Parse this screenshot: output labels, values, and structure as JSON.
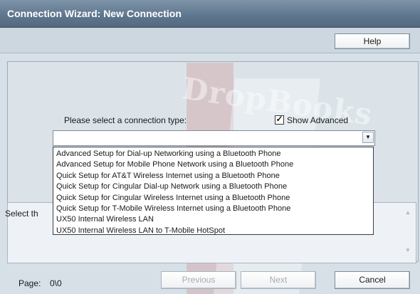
{
  "window": {
    "title": "Connection Wizard: New Connection"
  },
  "toolbar": {
    "help_label": "Help"
  },
  "form": {
    "prompt": "Please select a connection type:",
    "show_advanced_label": "Show Advanced",
    "show_advanced_checked": true,
    "combo_value": ""
  },
  "dropdown": {
    "options": [
      "Advanced Setup for Dial-up Networking using a Bluetooth Phone",
      "Advanced Setup for Mobile Phone Network using a Bluetooth Phone",
      "Quick Setup for AT&T Wireless Internet using a Bluetooth Phone",
      "Quick Setup for Cingular Dial-up Network using a Bluetooth Phone",
      "Quick Setup for Cingular Wireless Internet using a Bluetooth Phone",
      "Quick Setup for T-Mobile Wireless Internet using a Bluetooth Phone",
      "UX50 Internal Wireless LAN",
      "UX50 Internal Wireless LAN to T-Mobile HotSpot"
    ]
  },
  "description": {
    "label_partial": "Select th"
  },
  "footer": {
    "page_label": "Page:",
    "page_value": "0\\0",
    "previous_label": "Previous",
    "next_label": "Next",
    "cancel_label": "Cancel"
  },
  "watermark": {
    "text": "DropBooks"
  },
  "colors": {
    "titlebar": "#5f7890",
    "background": "#d7e0e7",
    "disabled_text": "#a4adb5"
  }
}
